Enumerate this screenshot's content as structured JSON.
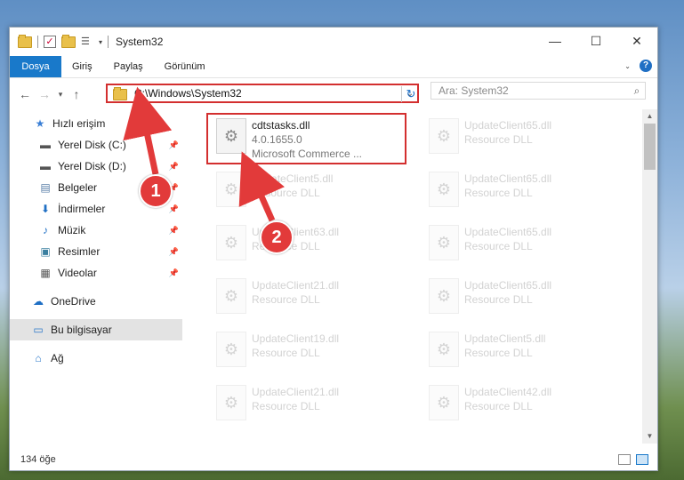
{
  "window": {
    "title": "System32",
    "controls": {
      "minimize": "—",
      "maximize": "☐",
      "close": "✕"
    }
  },
  "ribbon": {
    "tabs": [
      "Dosya",
      "Giriş",
      "Paylaş",
      "Görünüm"
    ]
  },
  "address": {
    "path": "C:\\Windows\\System32",
    "refresh_icon": "↻"
  },
  "search": {
    "placeholder": "Ara: System32"
  },
  "sidebar": {
    "items": [
      {
        "label": "Hızlı erişim",
        "icon": "★",
        "color": "#3a7fd5",
        "pinned": false
      },
      {
        "label": "Yerel Disk (C:)",
        "icon": "▬",
        "color": "#555",
        "pinned": true
      },
      {
        "label": "Yerel Disk (D:)",
        "icon": "▬",
        "color": "#555",
        "pinned": true
      },
      {
        "label": "Belgeler",
        "icon": "▤",
        "color": "#5a7fa8",
        "pinned": true
      },
      {
        "label": "İndirmeler",
        "icon": "⬇",
        "color": "#1f6fc4",
        "pinned": true
      },
      {
        "label": "Müzik",
        "icon": "♪",
        "color": "#1f6fc4",
        "pinned": true
      },
      {
        "label": "Resimler",
        "icon": "▣",
        "color": "#3a7fa0",
        "pinned": true
      },
      {
        "label": "Videolar",
        "icon": "▦",
        "color": "#555",
        "pinned": true
      },
      {
        "label": "OneDrive",
        "icon": "☁",
        "color": "#1f6fc4",
        "pinned": false
      },
      {
        "label": "Bu bilgisayar",
        "icon": "▭",
        "color": "#2a77c9",
        "pinned": false,
        "selected": true
      },
      {
        "label": "Ağ",
        "icon": "⌂",
        "color": "#2a77c9",
        "pinned": false
      }
    ]
  },
  "files": [
    {
      "name": "cdtstasks.dll",
      "version": "4.0.1655.0",
      "company": "Microsoft Commerce ...",
      "ghost": false
    },
    {
      "name": "UpdateClient65.dll",
      "desc": "Resource DLL",
      "ghost": true
    },
    {
      "name": "UpdateClient5.dll",
      "desc": "Resource DLL",
      "ghost": true
    },
    {
      "name": "UpdateClient65.dll",
      "desc": "Resource DLL",
      "ghost": true
    },
    {
      "name": "UpdateClient63.dll",
      "desc": "Resource DLL",
      "ghost": true
    },
    {
      "name": "UpdateClient65.dll",
      "desc": "Resource DLL",
      "ghost": true
    },
    {
      "name": "UpdateClient21.dll",
      "desc": "Resource DLL",
      "ghost": true
    },
    {
      "name": "UpdateClient65.dll",
      "desc": "Resource DLL",
      "ghost": true
    },
    {
      "name": "UpdateClient19.dll",
      "desc": "Resource DLL",
      "ghost": true
    },
    {
      "name": "UpdateClient5.dll",
      "desc": "Resource DLL",
      "ghost": true
    },
    {
      "name": "UpdateClient21.dll",
      "desc": "Resource DLL",
      "ghost": true
    },
    {
      "name": "UpdateClient42.dll",
      "desc": "Resource DLL",
      "ghost": true
    }
  ],
  "status": {
    "count": "134 öğe"
  },
  "callouts": [
    "1",
    "2"
  ],
  "colors": {
    "accent": "#1979ca",
    "highlight": "#d32f2f",
    "callout": "#e23a3a"
  }
}
